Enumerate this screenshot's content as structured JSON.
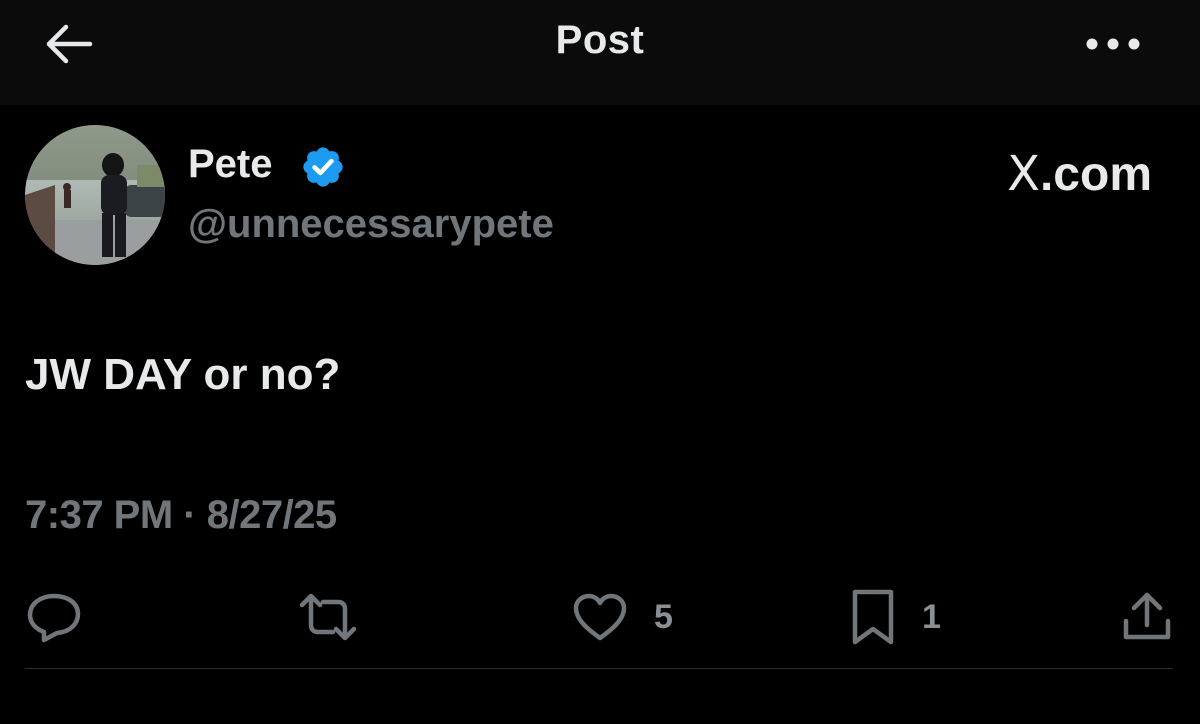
{
  "header": {
    "title": "Post",
    "back_icon": "arrow-left-icon",
    "more_icon": "more-horizontal-icon"
  },
  "author": {
    "name": "Pete",
    "handle": "@unnecessarypete",
    "verified": true,
    "verified_color": "#1d9bf0"
  },
  "brand": {
    "text": ".com",
    "logo": "X"
  },
  "post": {
    "text": "JW DAY or no?",
    "timestamp": "7:37 PM · 8/27/25"
  },
  "actions": {
    "reply": {
      "icon": "reply-icon",
      "count": ""
    },
    "repost": {
      "icon": "repost-icon",
      "count": ""
    },
    "like": {
      "icon": "heart-icon",
      "count": "5"
    },
    "bookmark": {
      "icon": "bookmark-icon",
      "count": "1"
    },
    "share": {
      "icon": "share-icon",
      "count": ""
    }
  },
  "colors": {
    "background": "#000000",
    "header_background": "#0b0b0b",
    "primary_text": "#e7e9ea",
    "secondary_text": "#71767b"
  }
}
